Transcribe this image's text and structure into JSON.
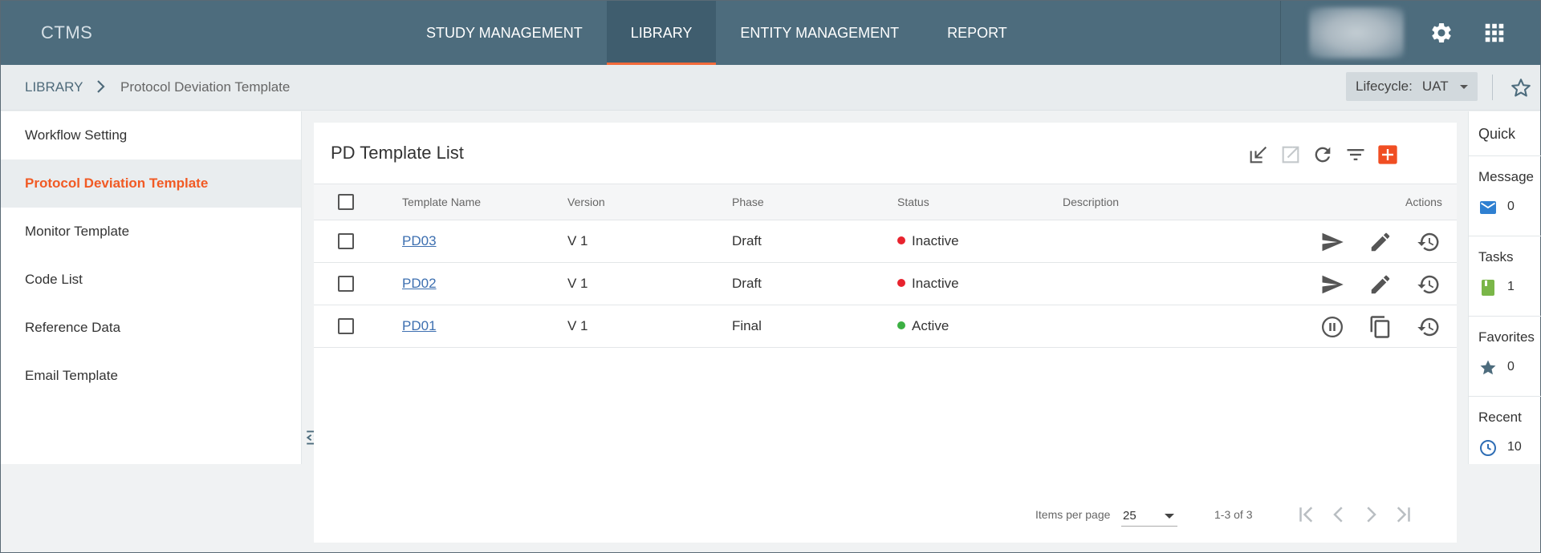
{
  "app": {
    "brand": "CTMS"
  },
  "nav": {
    "items": [
      {
        "label": "STUDY MANAGEMENT"
      },
      {
        "label": "LIBRARY"
      },
      {
        "label": "ENTITY MANAGEMENT"
      },
      {
        "label": "REPORT"
      }
    ],
    "active": "LIBRARY"
  },
  "breadcrumb": {
    "root": "LIBRARY",
    "current": "Protocol Deviation Template"
  },
  "lifecycle": {
    "label": "Lifecycle:",
    "value": "UAT"
  },
  "sidebar": {
    "items": [
      {
        "label": "Workflow Setting"
      },
      {
        "label": "Protocol Deviation Template"
      },
      {
        "label": "Monitor Template"
      },
      {
        "label": "Code List"
      },
      {
        "label": "Reference Data"
      },
      {
        "label": "Email Template"
      }
    ],
    "active": "Protocol Deviation Template"
  },
  "main": {
    "title": "PD Template List",
    "toolbar_icons": [
      "import-icon",
      "export-icon",
      "refresh-icon",
      "filter-icon",
      "add-icon"
    ],
    "columns": {
      "name": "Template Name",
      "version": "Version",
      "phase": "Phase",
      "status": "Status",
      "description": "Description",
      "actions": "Actions"
    },
    "rows": [
      {
        "name": "PD03",
        "version": "V 1",
        "phase": "Draft",
        "status": "Inactive",
        "description": "",
        "status_color": "#e8232e",
        "actions": [
          "send-icon",
          "edit-icon",
          "history-icon"
        ]
      },
      {
        "name": "PD02",
        "version": "V 1",
        "phase": "Draft",
        "status": "Inactive",
        "description": "",
        "status_color": "#e8232e",
        "actions": [
          "send-icon",
          "edit-icon",
          "history-icon"
        ]
      },
      {
        "name": "PD01",
        "version": "V 1",
        "phase": "Final",
        "status": "Active",
        "description": "",
        "status_color": "#3cb043",
        "actions": [
          "pause-icon",
          "copy-icon",
          "history-icon"
        ]
      }
    ],
    "pager": {
      "items_per_page_label": "Items per page",
      "items_per_page": "25",
      "range": "1-3 of 3"
    }
  },
  "quick": {
    "title": "Quick",
    "message": {
      "label": "Message",
      "count": "0"
    },
    "tasks": {
      "label": "Tasks",
      "count": "1"
    },
    "favorites": {
      "label": "Favorites",
      "count": "0"
    },
    "recent": {
      "label": "Recent",
      "count": "10"
    }
  },
  "colors": {
    "topbar": "#4d6c7d",
    "accent": "#f15a24",
    "add_button": "#f04e23",
    "message_icon": "#2f80d1",
    "tasks_icon": "#7ab648",
    "favorites_icon": "#4d6c7d",
    "recent_icon": "#2f6eb5"
  }
}
